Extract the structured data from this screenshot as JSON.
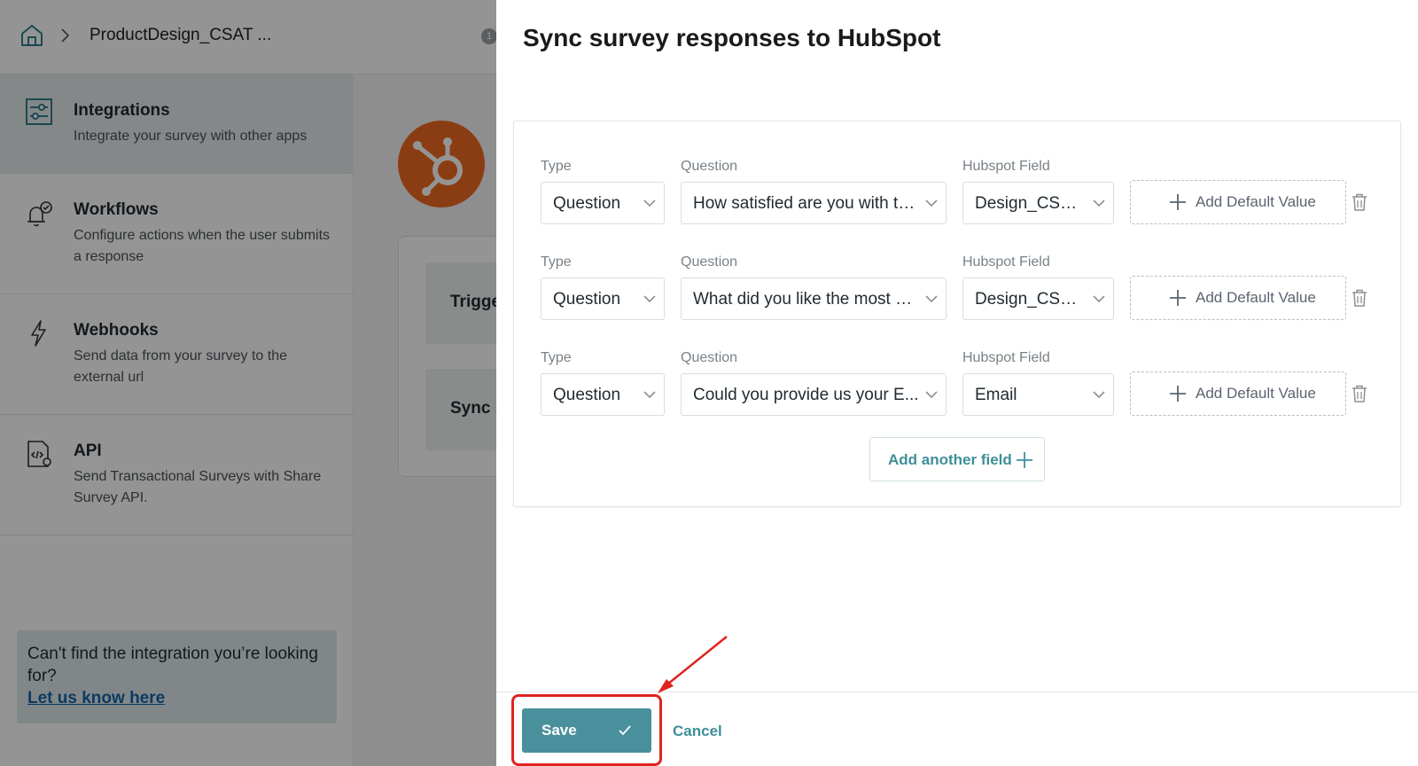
{
  "breadcrumb": {
    "survey_name": "ProductDesign_CSAT ...",
    "badge": "1"
  },
  "sidebar": {
    "items": [
      {
        "title": "Integrations",
        "description": "Integrate your survey with other apps"
      },
      {
        "title": "Workflows",
        "description": "Configure actions when the user submits a response"
      },
      {
        "title": "Webhooks",
        "description": "Send data from your survey to the external url"
      },
      {
        "title": "API",
        "description": "Send Transactional Surveys with Share Survey API."
      }
    ],
    "help": {
      "text": "Can't find the integration you’re looking for?",
      "link": "Let us know here"
    }
  },
  "main": {
    "rows": [
      {
        "label": "Trigge"
      },
      {
        "label": "Sync s"
      }
    ]
  },
  "drawer": {
    "title": "Sync survey responses to HubSpot",
    "labels": {
      "type": "Type",
      "question": "Question",
      "hubspot_field": "Hubspot Field"
    },
    "mappings": [
      {
        "type": "Question",
        "question": "How satisfied are you with th...",
        "hubspot_field": "Design_CSAT ...",
        "default_label": "Add Default Value"
      },
      {
        "type": "Question",
        "question": "What did you like the most ab...",
        "hubspot_field": "Design_CSAT ...",
        "default_label": "Add Default Value"
      },
      {
        "type": "Question",
        "question": "Could you provide us your E...",
        "hubspot_field": "Email",
        "default_label": "Add Default Value"
      }
    ],
    "add_field_label": "Add another field",
    "footer": {
      "save_label": "Save",
      "cancel_label": "Cancel"
    }
  },
  "colors": {
    "accent": "#4a8f9c",
    "hubspot_orange": "#ee6a1f",
    "annotation_red": "#e0231f"
  }
}
